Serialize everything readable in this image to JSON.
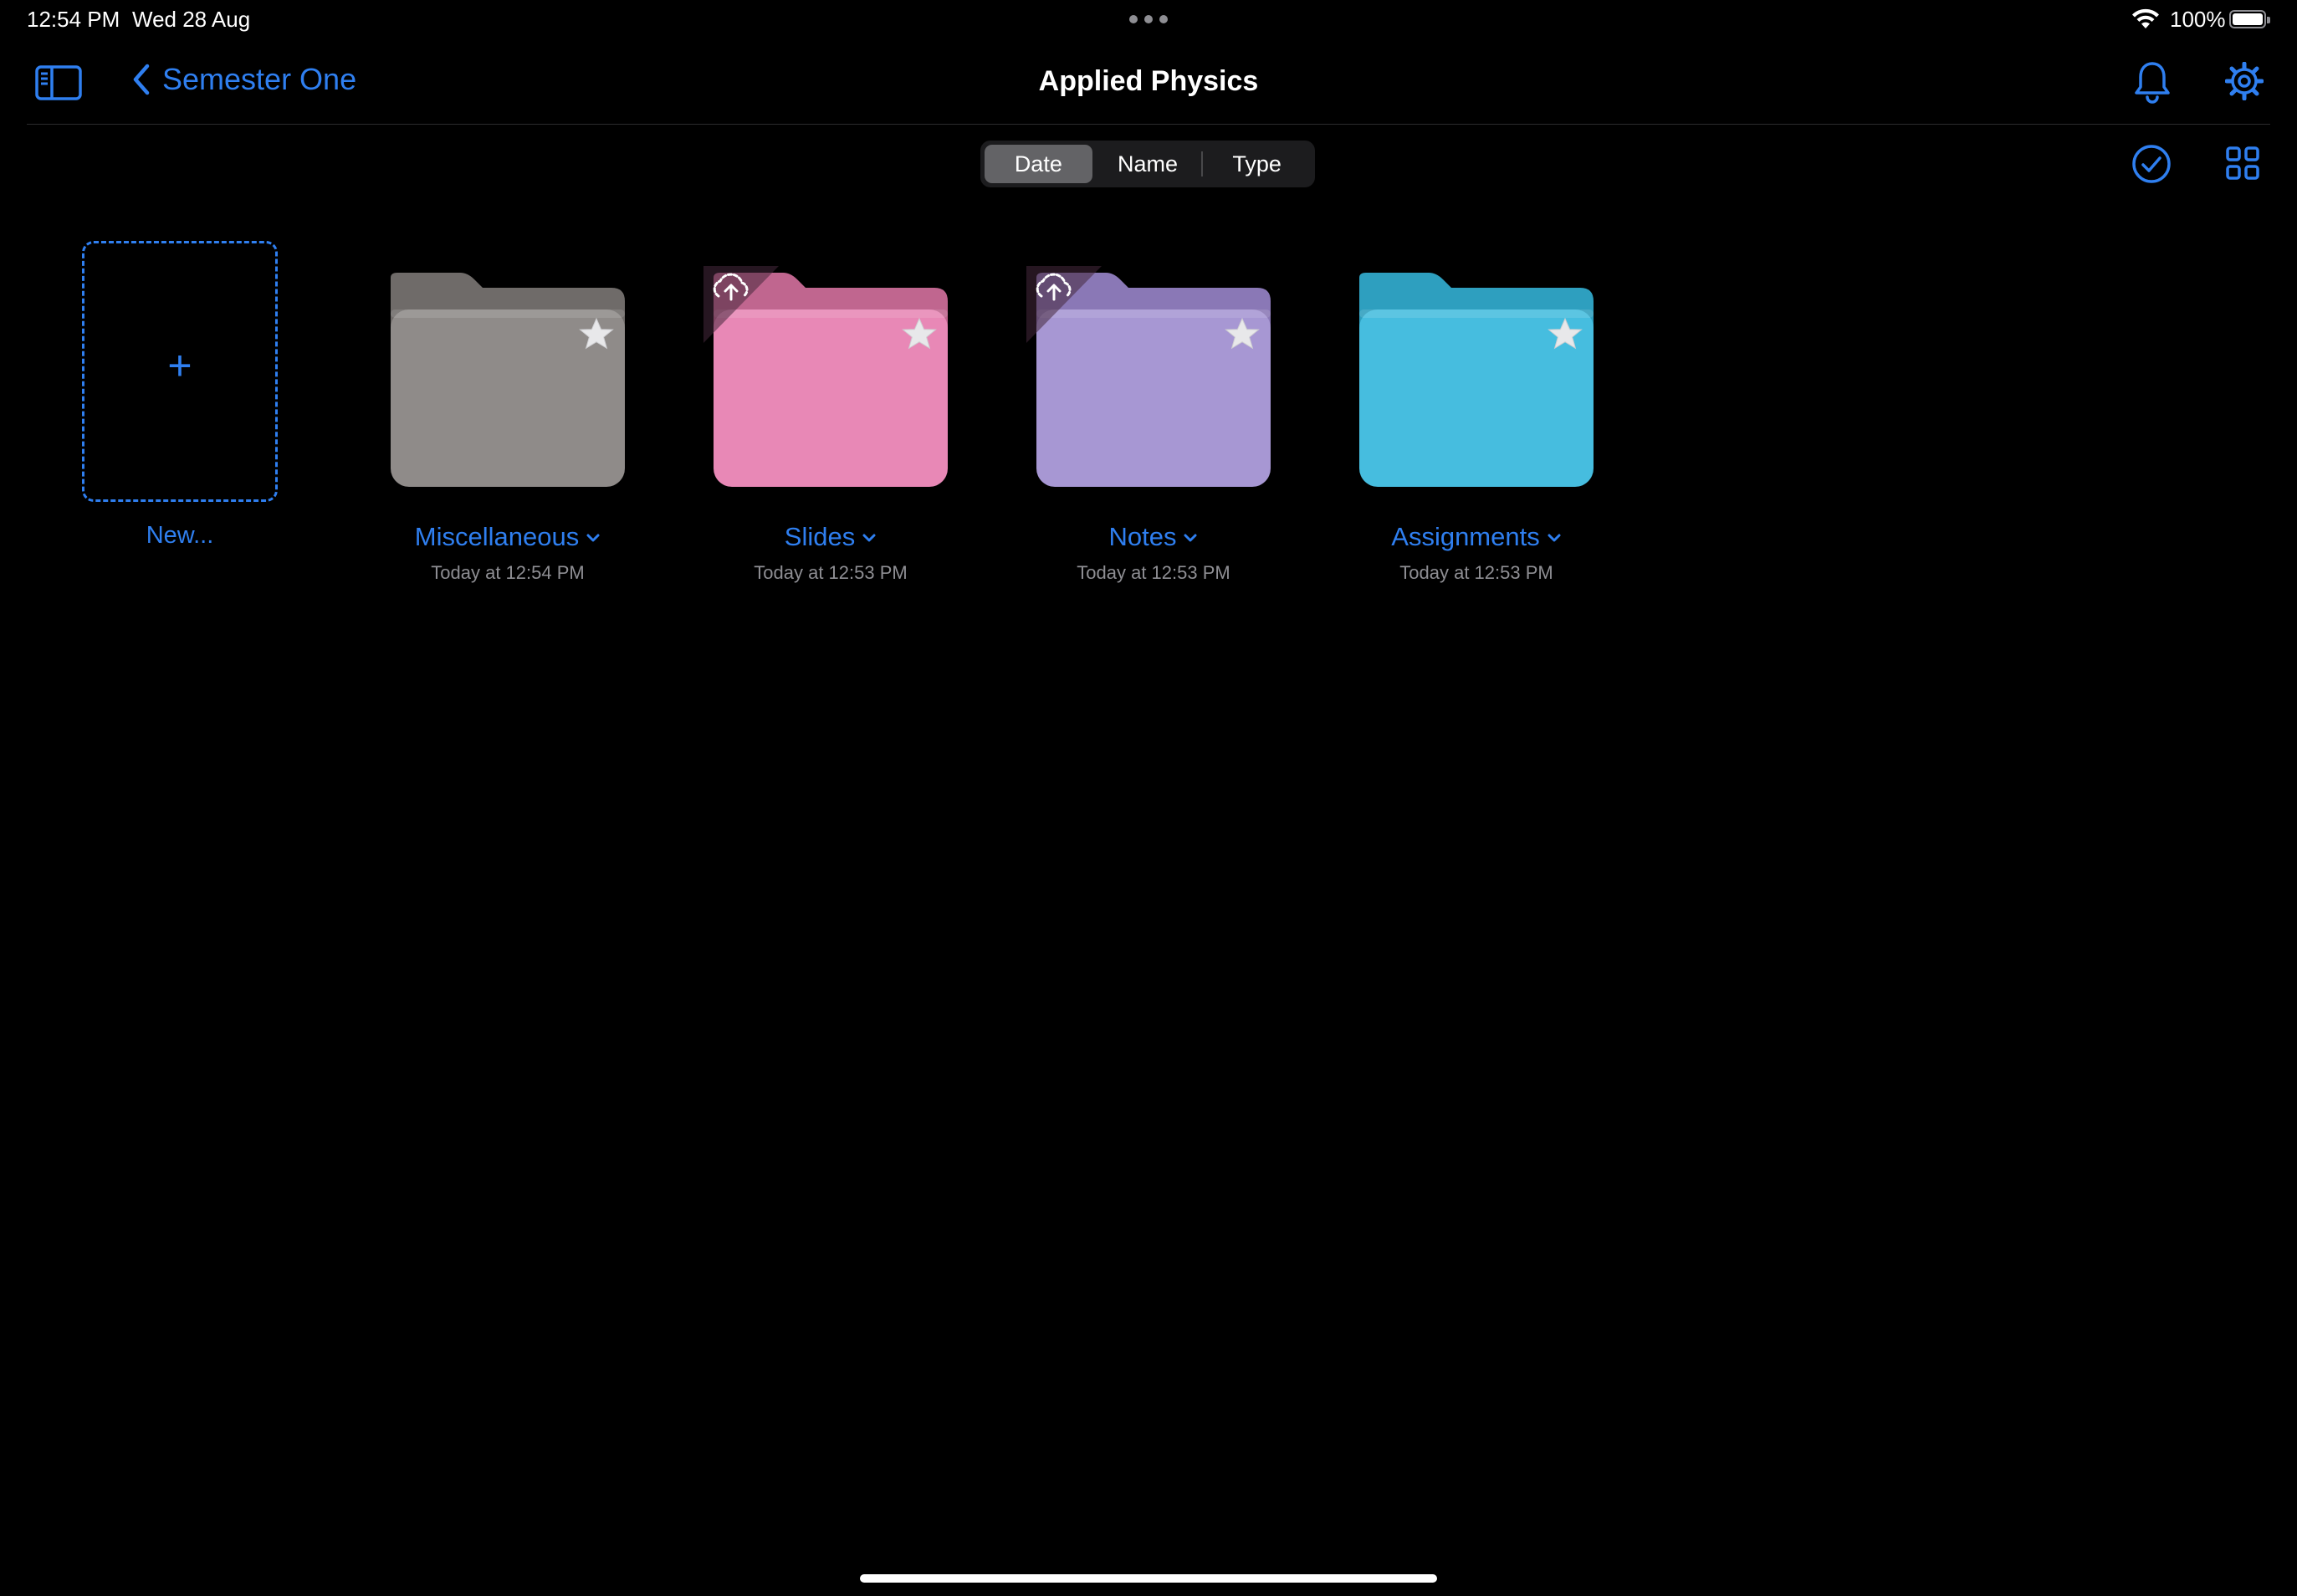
{
  "status_bar": {
    "time": "12:54 PM",
    "date": "Wed 28 Aug",
    "battery_percent": "100%",
    "icons": [
      "wifi-icon",
      "battery-icon",
      "multitasking-dots-icon"
    ]
  },
  "nav": {
    "back_label": "Semester One",
    "title": "Applied Physics",
    "icons": [
      "sidebar-toggle-icon",
      "chevron-left-icon",
      "bell-icon",
      "gear-icon"
    ]
  },
  "sort": {
    "options": [
      "Date",
      "Name",
      "Type"
    ],
    "selected": "Date"
  },
  "toolbar_icons": [
    "select-checkmark-icon",
    "grid-view-icon"
  ],
  "new_item": {
    "plus": "+",
    "label": "New..."
  },
  "folders": [
    {
      "name": "Miscellaneous",
      "date": "Today at 12:54 PM",
      "color_back": "#6f6b69",
      "color_front": "#8f8b89",
      "upload_badge": false,
      "starred": false
    },
    {
      "name": "Slides",
      "date": "Today at 12:53 PM",
      "color_back": "#c0668f",
      "color_front": "#e888b6",
      "upload_badge": true,
      "starred": false
    },
    {
      "name": "Notes",
      "date": "Today at 12:53 PM",
      "color_back": "#8a78b6",
      "color_front": "#a797d3",
      "upload_badge": true,
      "starred": false
    },
    {
      "name": "Assignments",
      "date": "Today at 12:53 PM",
      "color_back": "#2e9fbf",
      "color_front": "#46bddf",
      "upload_badge": false,
      "starred": false
    }
  ],
  "colors": {
    "accent": "#2f7ff0",
    "background": "#000000",
    "secondary_text": "#8e8e93"
  }
}
